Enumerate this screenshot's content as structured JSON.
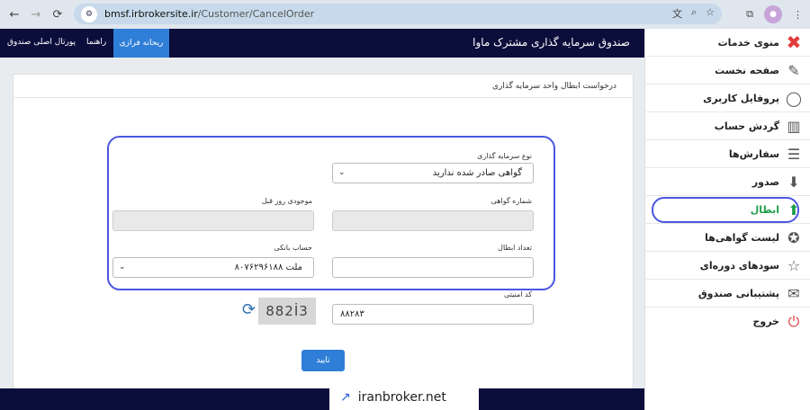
{
  "browser": {
    "url_host": "bmsf.irbrokersite.ir",
    "url_path": "/Customer/CancelOrder"
  },
  "header": {
    "title": "صندوق سرمایه گذاری مشترک ماوا",
    "nav_portal": "پورتال اصلی صندوق",
    "nav_help": "راهنما",
    "nav_mobile": "ریحانه فرازی"
  },
  "sidebar": {
    "items": [
      {
        "label": "منوی خدمات",
        "icon": "close-icon"
      },
      {
        "label": "صفحه نخست",
        "icon": "home-icon"
      },
      {
        "label": "پروفایل کاربری",
        "icon": "user-icon"
      },
      {
        "label": "گردش حساب",
        "icon": "chart-icon"
      },
      {
        "label": "سفارش‌ها",
        "icon": "orders-icon"
      },
      {
        "label": "صدور",
        "icon": "arrow-down-icon"
      },
      {
        "label": "ابطال",
        "icon": "arrow-up-icon"
      },
      {
        "label": "لیست گواهی‌ها",
        "icon": "certificate-icon"
      },
      {
        "label": "سودهای دوره‌ای",
        "icon": "star-icon"
      },
      {
        "label": "پشتیبانی صندوق",
        "icon": "mail-icon"
      },
      {
        "label": "خروج",
        "icon": "power-icon"
      }
    ]
  },
  "card": {
    "title": "درخواست ابطال واحد سرمایه گذاری"
  },
  "form": {
    "investment_type_label": "نوع سرمایه گذاری",
    "investment_type_value": "گواهی صادر شده ندارید",
    "cert_number_label": "شماره گواهی",
    "prev_balance_label": "موجودی روز قبل",
    "cancel_count_label": "تعداد ابطال",
    "bank_account_label": "حساب بانکی",
    "bank_account_value": "۸۰۷۶۲۹۶۱۸۸ ملت",
    "security_code_label": "کد امنیتی",
    "security_code_value": "۸۸۲۸۳",
    "captcha_text": "882İ3",
    "submit_label": "تایید"
  },
  "watermark": {
    "text": "iranbroker.net"
  },
  "colors": {
    "navbar": "#0b0d3b",
    "accent": "#2f7fd8",
    "highlight": "#4a57e0",
    "active": "#1e9e4a"
  }
}
